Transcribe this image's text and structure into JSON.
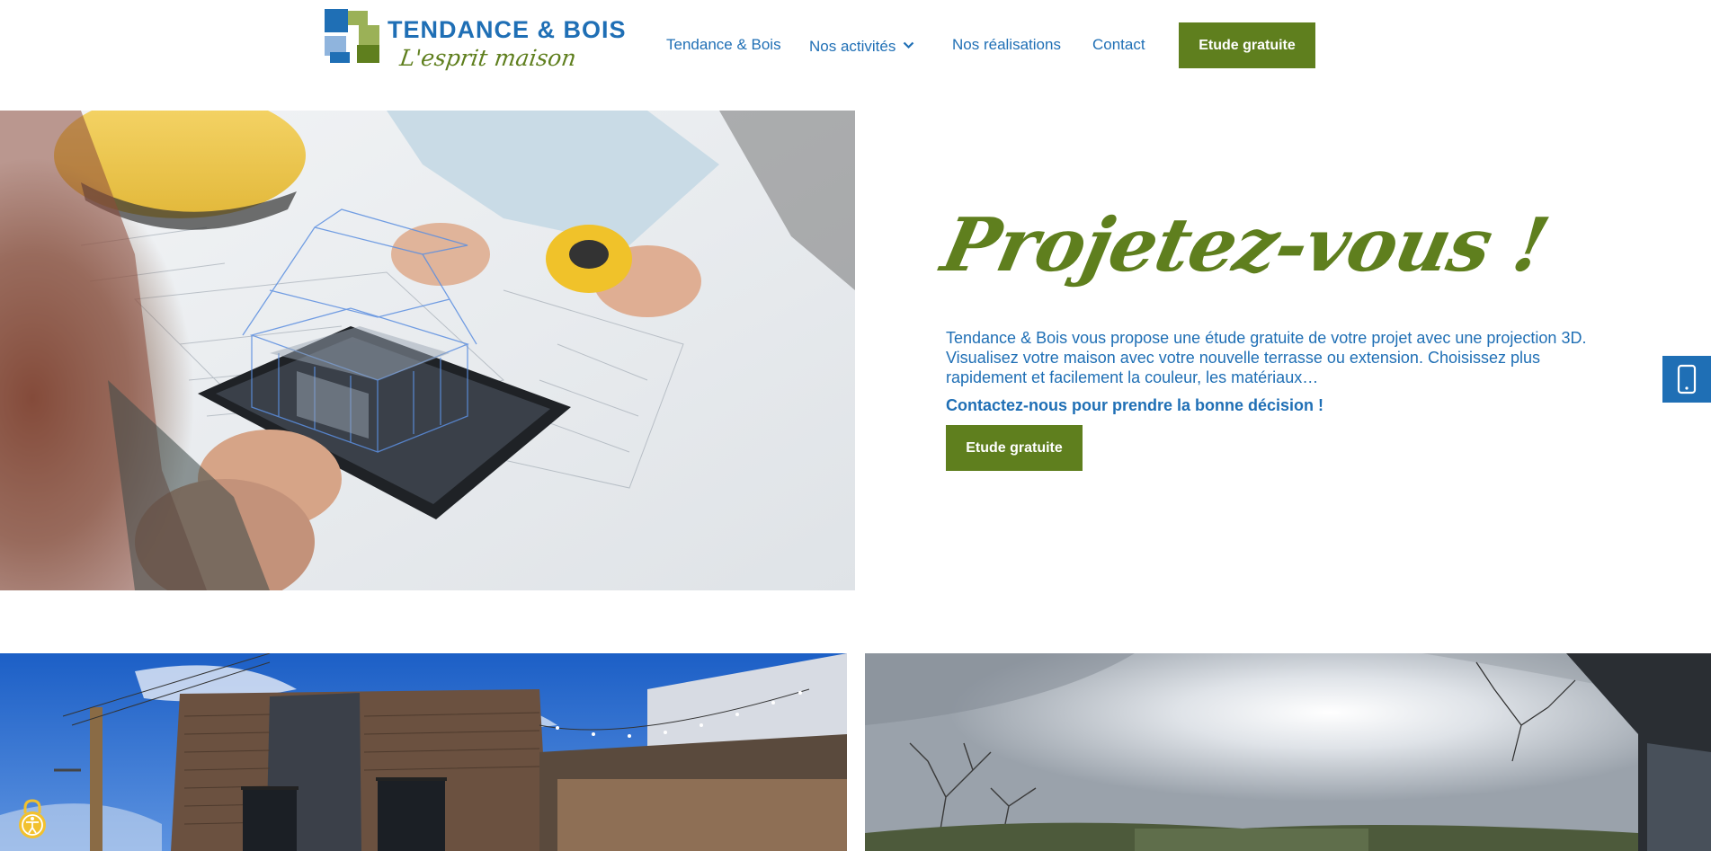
{
  "header": {
    "logo_title": "TENDANCE & BOIS",
    "logo_tagline": "L'esprit maison",
    "nav": [
      {
        "label": "Tendance & Bois"
      },
      {
        "label": "Nos activités",
        "has_dropdown": true
      },
      {
        "label": "Nos réalisations"
      },
      {
        "label": "Contact"
      }
    ],
    "cta_label": "Etude gratuite"
  },
  "hero": {
    "title": "Projetez-vous !",
    "paragraph": "Tendance & Bois vous propose une étude gratuite de votre projet avec une projection 3D. Visualisez votre maison avec votre nouvelle terrasse ou extension. Choisissez plus rapidement et facilement la couleur, les matériaux…",
    "bold_line": "Contactez-nous pour prendre la bonne décision !",
    "button_label": "Etude gratuite"
  },
  "side_tab": {
    "icon": "mobile-phone-icon"
  },
  "accessibility": {
    "icon": "accessibility-icon"
  },
  "colors": {
    "brand_blue": "#1f6fb5",
    "brand_green": "#5f7f1e",
    "logo_light_green": "#9bb157",
    "logo_light_blue": "#8fb4dd"
  }
}
